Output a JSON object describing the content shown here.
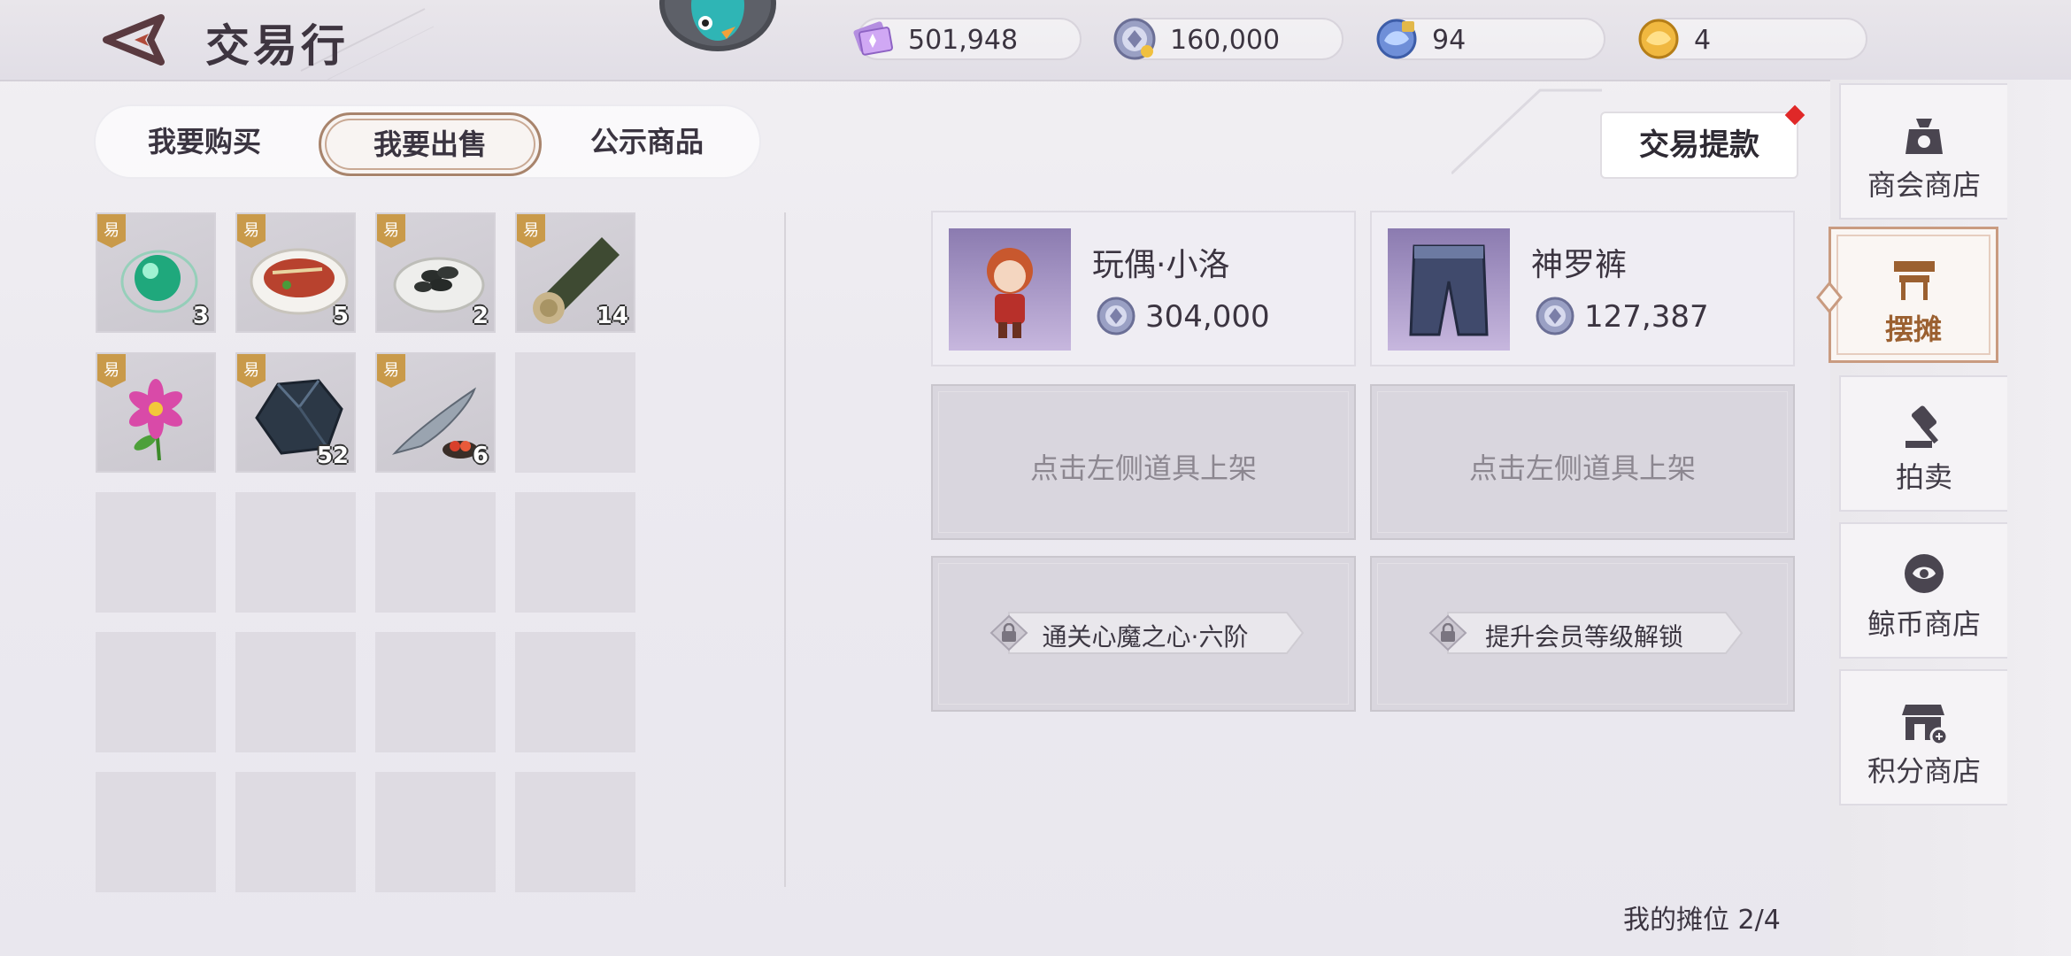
{
  "header": {
    "title": "交易行",
    "currencies": [
      {
        "icon": "crystal-ticket-icon",
        "value": "501,948"
      },
      {
        "icon": "silver-coin-icon",
        "value": "160,000"
      },
      {
        "icon": "whale-token-locked-icon",
        "value": "94"
      },
      {
        "icon": "gold-whale-coin-icon",
        "value": "4"
      }
    ]
  },
  "tabs": [
    {
      "label": "我要购买",
      "active": false
    },
    {
      "label": "我要出售",
      "active": true
    },
    {
      "label": "公示商品",
      "active": false
    }
  ],
  "inventory": {
    "tag_label": "易",
    "items": [
      {
        "name": "green-orb",
        "count": "3"
      },
      {
        "name": "fish-dish",
        "count": "5"
      },
      {
        "name": "mussel-dish",
        "count": "2"
      },
      {
        "name": "wood-log",
        "count": "14"
      },
      {
        "name": "pink-flower",
        "count": ""
      },
      {
        "name": "dark-ore",
        "count": "52"
      },
      {
        "name": "fish-with-tomato",
        "count": "6"
      }
    ]
  },
  "withdraw_label": "交易提款",
  "stall": {
    "listings": [
      {
        "name": "玩偶·小洛",
        "price": "304,000"
      },
      {
        "name": "神罗裤",
        "price": "127,387"
      }
    ],
    "empty_slot_text": "点击左侧道具上架",
    "locked_slots": [
      "通关心魔之心·六阶",
      "提升会员等级解锁"
    ],
    "slot_count_label": "我的摊位",
    "slot_count": "2/4"
  },
  "side_nav": [
    {
      "label": "商会商店",
      "icon": "merchant-shop-icon",
      "active": false
    },
    {
      "label": "摆摊",
      "icon": "stall-icon",
      "active": true
    },
    {
      "label": "拍卖",
      "icon": "auction-gavel-icon",
      "active": false
    },
    {
      "label": "鲸币商店",
      "icon": "whale-coin-shop-icon",
      "active": false
    },
    {
      "label": "积分商店",
      "icon": "points-shop-icon",
      "active": false
    }
  ],
  "colors": {
    "accent": "#a8846c",
    "active_nav_text": "#9b6030",
    "notify": "#e02828"
  }
}
